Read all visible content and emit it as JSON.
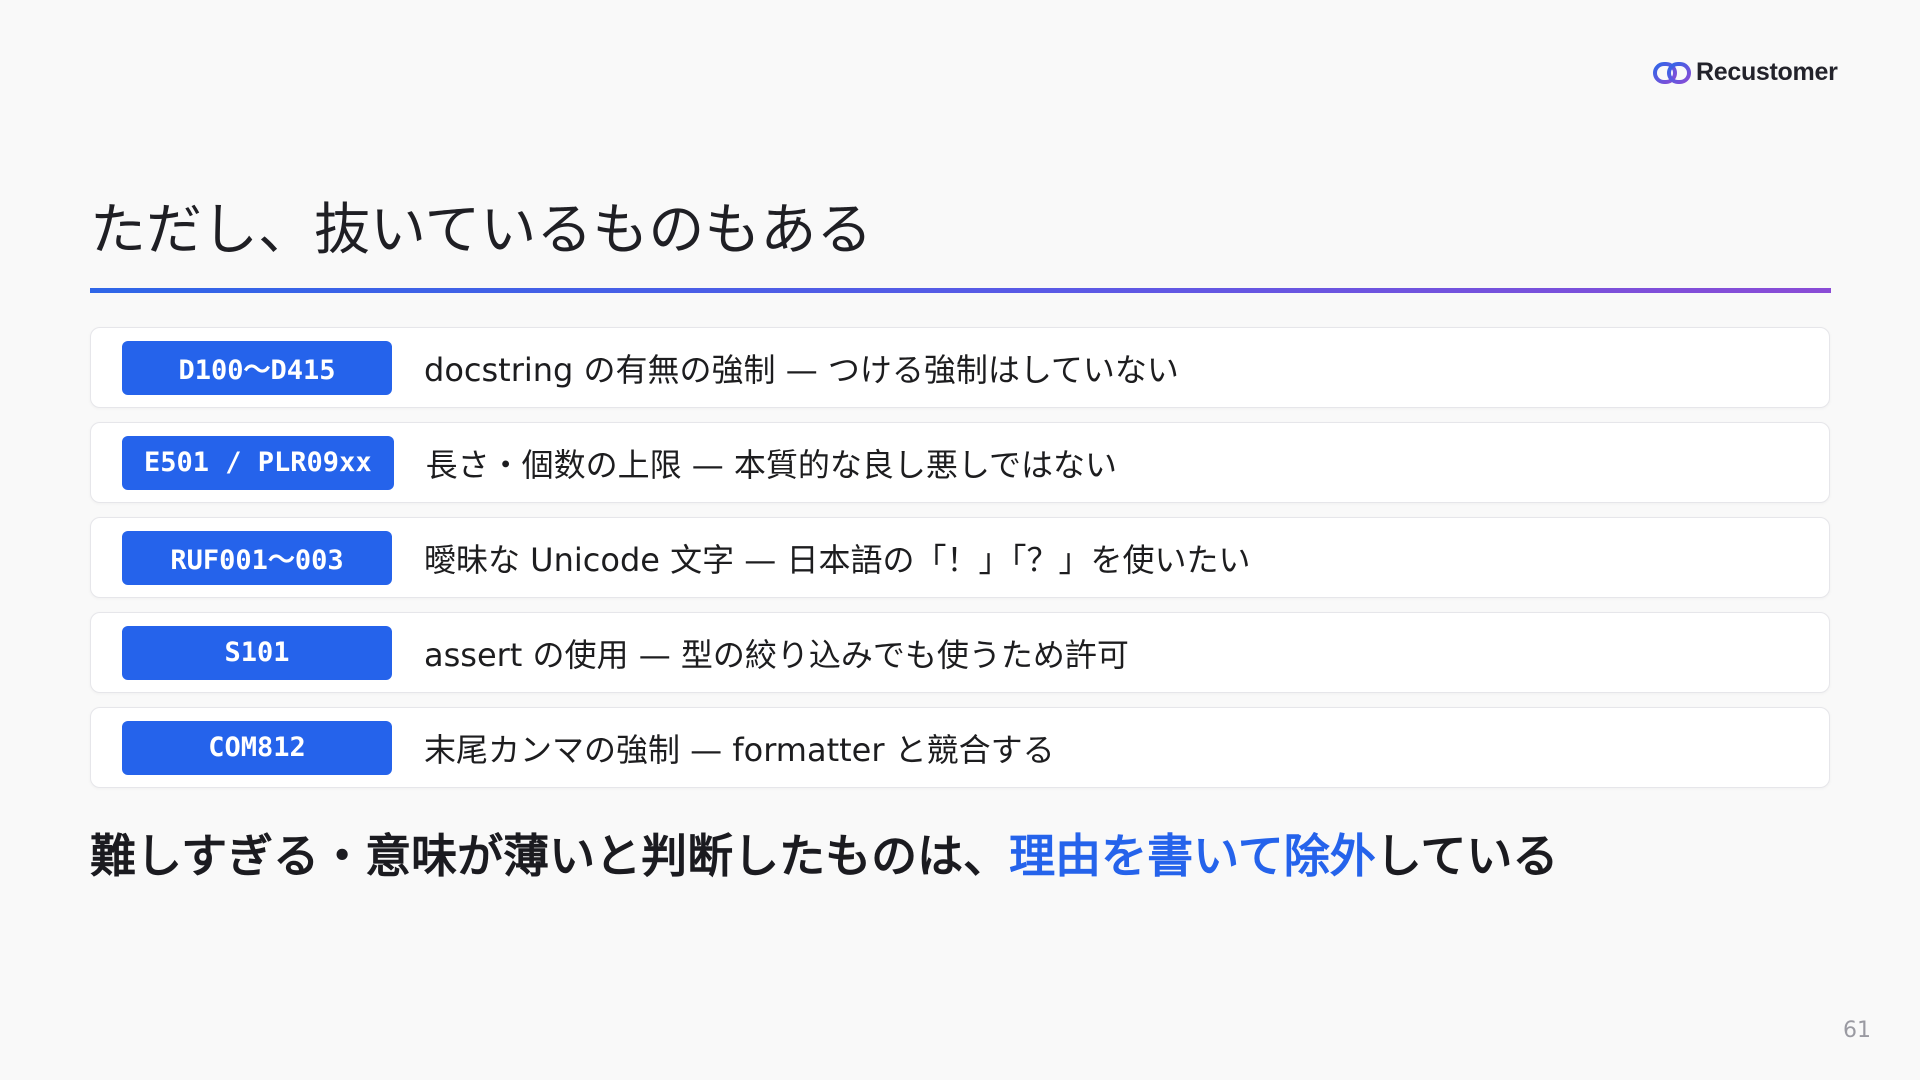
{
  "brand": {
    "name": "Recustomer",
    "accent": "#2563eb"
  },
  "title": "ただし、抜いているものもある",
  "rules": [
    {
      "code": "D100〜D415",
      "description": "docstring の有無の強制 — つける強制はしていない"
    },
    {
      "code": "E501 / PLR09xx",
      "description": "長さ・個数の上限 — 本質的な良し悪しではない"
    },
    {
      "code": "RUF001〜003",
      "description": "曖昧な Unicode 文字 — 日本語の「！」「？」を使いたい"
    },
    {
      "code": "S101",
      "description": "assert の使用 — 型の絞り込みでも使うため許可"
    },
    {
      "code": "COM812",
      "description": "末尾カンマの強制 — formatter と競合する"
    }
  ],
  "conclusion": {
    "before": "難しすぎる・意味が薄いと判断したものは、",
    "highlight": "理由を書いて除外",
    "after": "している"
  },
  "page_number": "61"
}
